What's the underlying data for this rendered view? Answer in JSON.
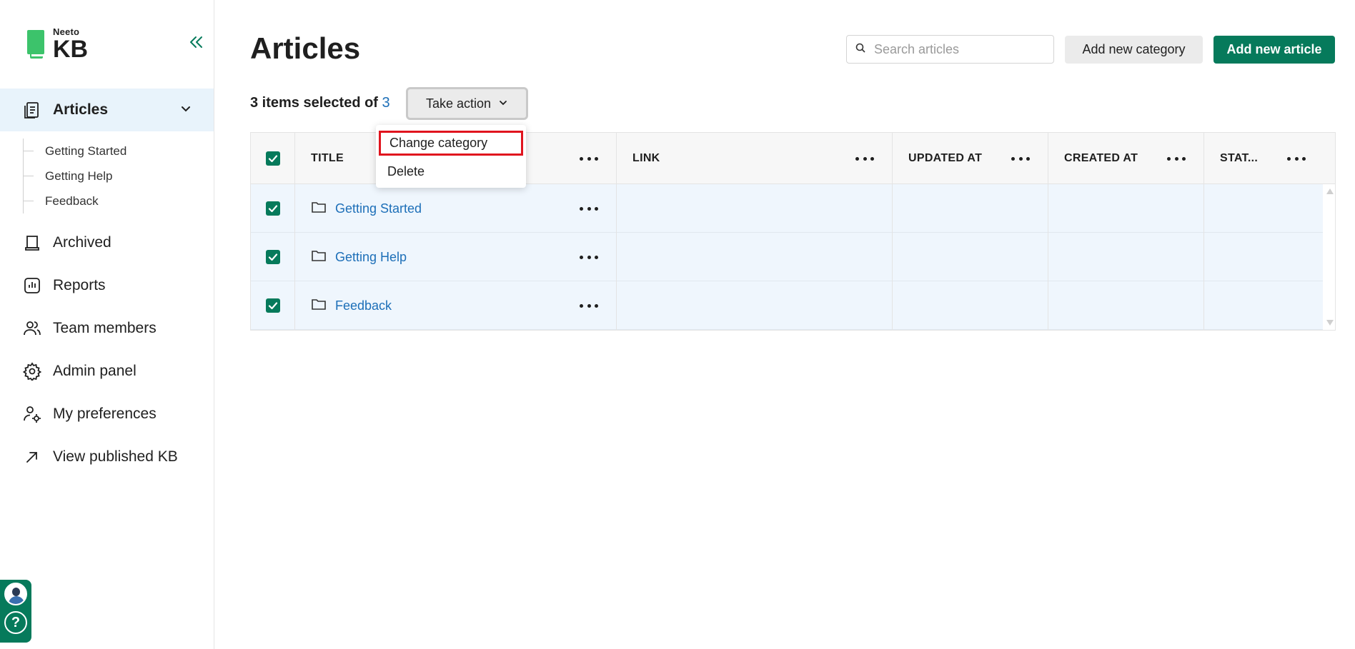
{
  "brand": {
    "small": "Neeto",
    "big": "KB",
    "accent": "#067a5b",
    "logo_color": "#3cc36b"
  },
  "sidebar": {
    "collapse_icon": "double-chevron-left-icon",
    "active": {
      "label": "Articles",
      "icon": "articles-icon"
    },
    "sub_items": [
      "Getting Started",
      "Getting Help",
      "Feedback"
    ],
    "items": [
      {
        "label": "Archived",
        "icon": "archive-icon"
      },
      {
        "label": "Reports",
        "icon": "reports-icon"
      },
      {
        "label": "Team members",
        "icon": "team-icon"
      },
      {
        "label": "Admin panel",
        "icon": "gear-icon"
      },
      {
        "label": "My preferences",
        "icon": "user-settings-icon"
      },
      {
        "label": "View published KB",
        "icon": "external-arrow-icon"
      }
    ]
  },
  "header": {
    "title": "Articles",
    "search_placeholder": "Search articles",
    "add_category": "Add new category",
    "add_article": "Add new article"
  },
  "selection": {
    "prefix": "3 items selected of",
    "count": "3",
    "take_action": "Take action"
  },
  "dropdown": {
    "items": [
      "Change category",
      "Delete"
    ]
  },
  "table": {
    "columns": [
      "TITLE",
      "LINK",
      "UPDATED AT",
      "CREATED AT",
      "STAT..."
    ],
    "rows": [
      {
        "title": "Getting Started"
      },
      {
        "title": "Getting Help"
      },
      {
        "title": "Feedback"
      }
    ]
  }
}
